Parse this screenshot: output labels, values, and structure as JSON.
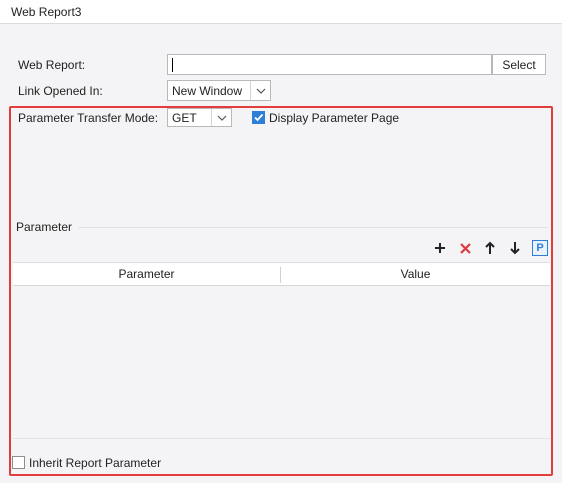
{
  "window": {
    "title": "Web Report3"
  },
  "form": {
    "web_report_label": "Web Report:",
    "web_report_value": "",
    "select_button": "Select",
    "link_opened_label": "Link Opened In:",
    "link_opened_value": "New Window"
  },
  "params": {
    "transfer_mode_label": "Parameter Transfer Mode:",
    "transfer_mode_value": "GET",
    "display_page_label": "Display Parameter Page",
    "display_page_checked": true,
    "section_title": "Parameter",
    "toolbar": {
      "add_icon": "plus-icon",
      "delete_icon": "close-icon",
      "up_icon": "arrow-up-icon",
      "down_icon": "arrow-down-icon",
      "param_icon": "parameter-icon",
      "param_glyph": "P"
    },
    "table": {
      "columns": [
        "Parameter",
        "Value"
      ],
      "rows": []
    },
    "inherit_label": "Inherit Report Parameter",
    "inherit_checked": false
  },
  "colors": {
    "highlight_border": "#e23c3c",
    "accent_blue": "#2f7fd8",
    "delete_red": "#e03a3a"
  }
}
